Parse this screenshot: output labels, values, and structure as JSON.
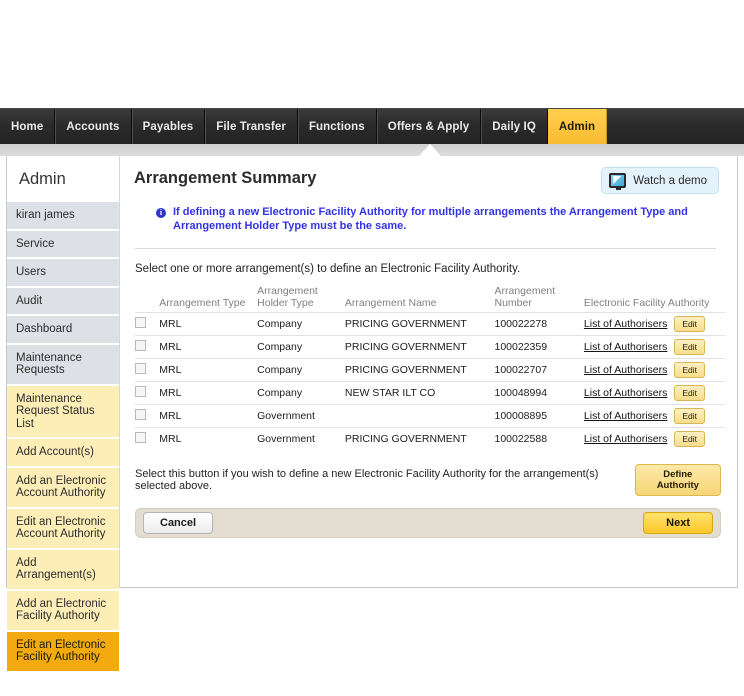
{
  "nav": {
    "tabs": [
      {
        "label": "Home",
        "active": false
      },
      {
        "label": "Accounts",
        "active": false
      },
      {
        "label": "Payables",
        "active": false
      },
      {
        "label": "File Transfer",
        "active": false
      },
      {
        "label": "Functions",
        "active": false
      },
      {
        "label": "Offers & Apply",
        "active": false
      },
      {
        "label": "Daily IQ",
        "active": false
      },
      {
        "label": "Admin",
        "active": true
      }
    ],
    "accent_color": "#f7bb2f"
  },
  "sidebar": {
    "title": "Admin",
    "items": [
      {
        "label": "kiran james",
        "style": "grey"
      },
      {
        "label": "Service",
        "style": "grey"
      },
      {
        "label": "Users",
        "style": "grey"
      },
      {
        "label": "Audit",
        "style": "grey"
      },
      {
        "label": "Dashboard",
        "style": "grey"
      },
      {
        "label": "Maintenance Requests",
        "style": "grey"
      },
      {
        "label": "Maintenance Request Status List",
        "style": "yellow"
      },
      {
        "label": "Add Account(s)",
        "style": "yellow"
      },
      {
        "label": "Add an Electronic Account Authority",
        "style": "yellow"
      },
      {
        "label": "Edit an Electronic Account Authority",
        "style": "yellow"
      },
      {
        "label": "Add Arrangement(s)",
        "style": "yellow"
      },
      {
        "label": "Add an Electronic Facility Authority",
        "style": "yellow"
      },
      {
        "label": "Edit an Electronic Facility Authority",
        "style": "active"
      }
    ]
  },
  "header": {
    "title": "Arrangement Summary",
    "watch_demo_label": "Watch a demo"
  },
  "info": {
    "text": "If defining a new Electronic Facility Authority for multiple arrangements the Arrangement Type and Arrangement Holder Type must be the same."
  },
  "main": {
    "instruction": "Select one or more arrangement(s) to define an Electronic Facility Authority.",
    "define_text": "Select this button if you wish to define a new Electronic Facility Authority for the arrangement(s) selected above.",
    "define_button": "Define Authority"
  },
  "table": {
    "columns": [
      "Arrangement Type",
      "Arrangement Holder Type",
      "Arrangement Name",
      "Arrangement Number",
      "Electronic Facility Authority"
    ],
    "auth_link_label": "List of Authorisers",
    "edit_label": "Edit",
    "rows": [
      {
        "checked": false,
        "type": "MRL",
        "holder": "Company",
        "name": "PRICING GOVERNMENT",
        "number": "100022278"
      },
      {
        "checked": false,
        "type": "MRL",
        "holder": "Company",
        "name": "PRICING GOVERNMENT",
        "number": "100022359"
      },
      {
        "checked": false,
        "type": "MRL",
        "holder": "Company",
        "name": "PRICING GOVERNMENT",
        "number": "100022707"
      },
      {
        "checked": false,
        "type": "MRL",
        "holder": "Company",
        "name": "NEW STAR ILT CO",
        "number": "100048994"
      },
      {
        "checked": false,
        "type": "MRL",
        "holder": "Government",
        "name": "",
        "number": "100008895"
      },
      {
        "checked": false,
        "type": "MRL",
        "holder": "Government",
        "name": "PRICING GOVERNMENT",
        "number": "100022588"
      }
    ]
  },
  "footer": {
    "cancel_label": "Cancel",
    "next_label": "Next"
  }
}
